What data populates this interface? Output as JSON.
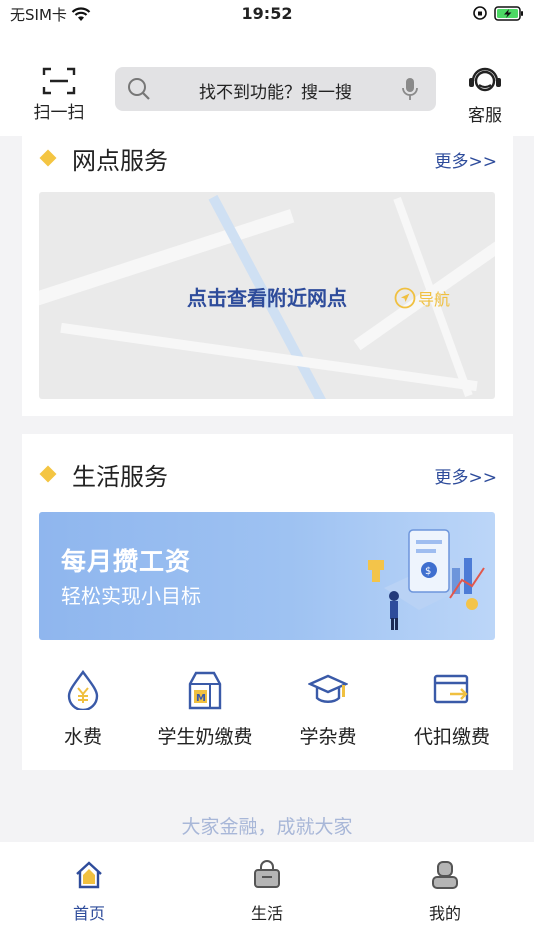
{
  "status": {
    "carrier": "无SIM卡",
    "time": "19:52"
  },
  "header": {
    "scan_label": "扫一扫",
    "search_placeholder": "找不到功能？搜一搜",
    "service_label": "客服"
  },
  "branch_section": {
    "title": "网点服务",
    "more": "更多>>",
    "map_label": "点击查看附近网点",
    "nav_label": "导航"
  },
  "life_section": {
    "title": "生活服务",
    "more": "更多>>",
    "banner_title": "每月攒工资",
    "banner_subtitle": "轻松实现小目标",
    "items": [
      {
        "label": "水费",
        "icon": "water-drop-yuan-icon"
      },
      {
        "label": "学生奶缴费",
        "icon": "milk-carton-icon"
      },
      {
        "label": "学杂费",
        "icon": "graduation-cap-icon"
      },
      {
        "label": "代扣缴费",
        "icon": "card-transfer-icon"
      }
    ]
  },
  "slogan": "大家金融，成就大家",
  "tabbar": {
    "items": [
      {
        "label": "首页",
        "active": true
      },
      {
        "label": "生活",
        "active": false
      },
      {
        "label": "我的",
        "active": false
      }
    ]
  },
  "colors": {
    "accent_blue": "#2e4c9b",
    "diamond_yellow": "#f4c542",
    "icon_blue": "#3a5aa8",
    "icon_yellow": "#f0c040"
  }
}
